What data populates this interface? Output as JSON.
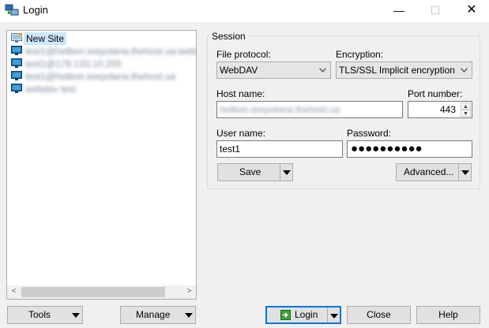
{
  "window": {
    "title": "Login",
    "minimize_glyph": "—",
    "maximize_glyph": "☐",
    "close_glyph": "✕"
  },
  "site_tree": {
    "items": [
      {
        "label": "New Site",
        "icon": "new-site-icon",
        "selected": true
      },
      {
        "label": "test1@hetbon.teepolana.thehost.ua:webdav",
        "icon": "computer-icon",
        "blurred": true
      },
      {
        "label": "test1@178.133.10.255",
        "icon": "computer-icon",
        "blurred": true
      },
      {
        "label": "test1@hetbon.teepolana.thehost.ua",
        "icon": "computer-icon",
        "blurred": true
      },
      {
        "label": "webdav test",
        "icon": "computer-icon",
        "blurred": true
      }
    ],
    "scroll_left": "<",
    "scroll_right": ">"
  },
  "session": {
    "caption": "Session",
    "file_protocol_label": "File protocol:",
    "file_protocol_value": "WebDAV",
    "encryption_label": "Encryption:",
    "encryption_value": "TLS/SSL Implicit encryption",
    "host_name_label": "Host name:",
    "host_name_value": "hetbon.teepolana.thehost.ua",
    "port_number_label": "Port number:",
    "port_number_value": "443",
    "user_name_label": "User name:",
    "user_name_value": "test1",
    "password_label": "Password:",
    "password_value": "●●●●●●●●●●",
    "save_label": "Save",
    "advanced_label": "Advanced..."
  },
  "footer": {
    "tools_label": "Tools",
    "manage_label": "Manage",
    "login_label": "Login",
    "close_label": "Close",
    "help_label": "Help"
  },
  "colors": {
    "selection": "#cce8ff",
    "default_button_border": "#0078d7",
    "login_icon": "#3ca33c",
    "computer_icon": "#1c6ea4"
  }
}
